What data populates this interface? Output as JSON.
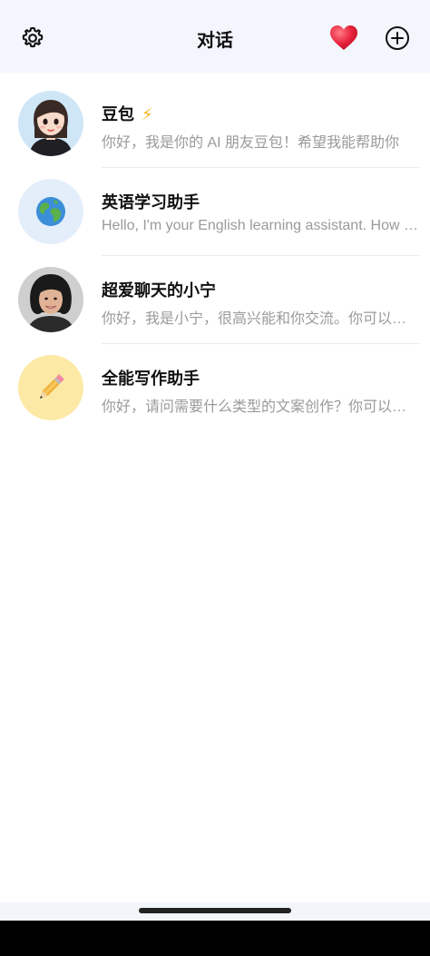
{
  "header": {
    "title": "对话",
    "icons": {
      "settings": "gear-icon",
      "favorite": "heart-icon",
      "add": "plus-circle-icon"
    },
    "colors": {
      "background": "#f3f6fc",
      "heart": "#e8213a"
    }
  },
  "conversations": [
    {
      "name": "豆包",
      "badge": "⚡",
      "preview": "你好，我是你的 AI 朋友豆包！希望我能帮助你",
      "avatar": "cartoon-girl-avatar"
    },
    {
      "name": "英语学习助手",
      "preview": "Hello, I'm your English learning assistant. How can I help",
      "avatar": "globe-avatar"
    },
    {
      "name": "超爱聊天的小宁",
      "preview": "你好，我是小宁，很高兴能和你交流。你可以和我聊",
      "avatar": "girl-photo-avatar"
    },
    {
      "name": "全能写作助手",
      "preview": "你好，请问需要什么类型的文案创作？你可以告诉我",
      "avatar": "pencil-avatar"
    }
  ]
}
